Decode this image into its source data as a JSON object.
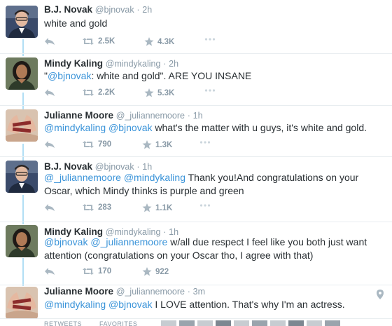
{
  "tweets": [
    {
      "name": "B.J. Novak",
      "handle": "@bjnovak",
      "time": "2h",
      "parts": [
        {
          "t": "white and gold",
          "link": false
        }
      ],
      "retweets": "2.5K",
      "favorites": "4.3K"
    },
    {
      "name": "Mindy Kaling",
      "handle": "@mindykaling",
      "time": "2h",
      "parts": [
        {
          "t": "\"",
          "link": false
        },
        {
          "t": "@bjnovak",
          "link": true
        },
        {
          "t": ": white and gold\". ARE YOU INSANE",
          "link": false
        }
      ],
      "retweets": "2.2K",
      "favorites": "5.3K"
    },
    {
      "name": "Julianne Moore",
      "handle": "@_juliannemoore",
      "time": "1h",
      "parts": [
        {
          "t": "@mindykaling",
          "link": true
        },
        {
          "t": " ",
          "link": false
        },
        {
          "t": "@bjnovak",
          "link": true
        },
        {
          "t": " what's the matter with u guys, it's white and gold.",
          "link": false
        }
      ],
      "retweets": "790",
      "favorites": "1.3K"
    },
    {
      "name": "B.J. Novak",
      "handle": "@bjnovak",
      "time": "1h",
      "parts": [
        {
          "t": "@_juliannemoore",
          "link": true
        },
        {
          "t": " ",
          "link": false
        },
        {
          "t": "@mindykaling",
          "link": true
        },
        {
          "t": " Thank you!And congratulations on your Oscar, which Mindy thinks is purple and green",
          "link": false
        }
      ],
      "retweets": "283",
      "favorites": "1.1K"
    },
    {
      "name": "Mindy Kaling",
      "handle": "@mindykaling",
      "time": "1h",
      "parts": [
        {
          "t": "@bjnovak",
          "link": true
        },
        {
          "t": " ",
          "link": false
        },
        {
          "t": "@_juliannemoore",
          "link": true
        },
        {
          "t": " w/all due respect I feel like you both just want attention (congratulations on your Oscar tho, I agree with that)",
          "link": false
        }
      ],
      "retweets": "170",
      "favorites": "922"
    },
    {
      "name": "Julianne Moore",
      "handle": "@_juliannemoore",
      "time": "3m",
      "parts": [
        {
          "t": "@mindykaling",
          "link": true
        },
        {
          "t": " ",
          "link": false
        },
        {
          "t": "@bjnovak",
          "link": true
        },
        {
          "t": " I LOVE attention. That's why I'm an actress.",
          "link": false
        }
      ],
      "retweets": "",
      "favorites": ""
    }
  ],
  "footer": {
    "retweets_label": "RETWEETS",
    "favorites_label": "FAVORITES"
  },
  "colors": {
    "link": "#3b94d9",
    "thread": "#b2dff5",
    "muted": "#8899a6"
  }
}
